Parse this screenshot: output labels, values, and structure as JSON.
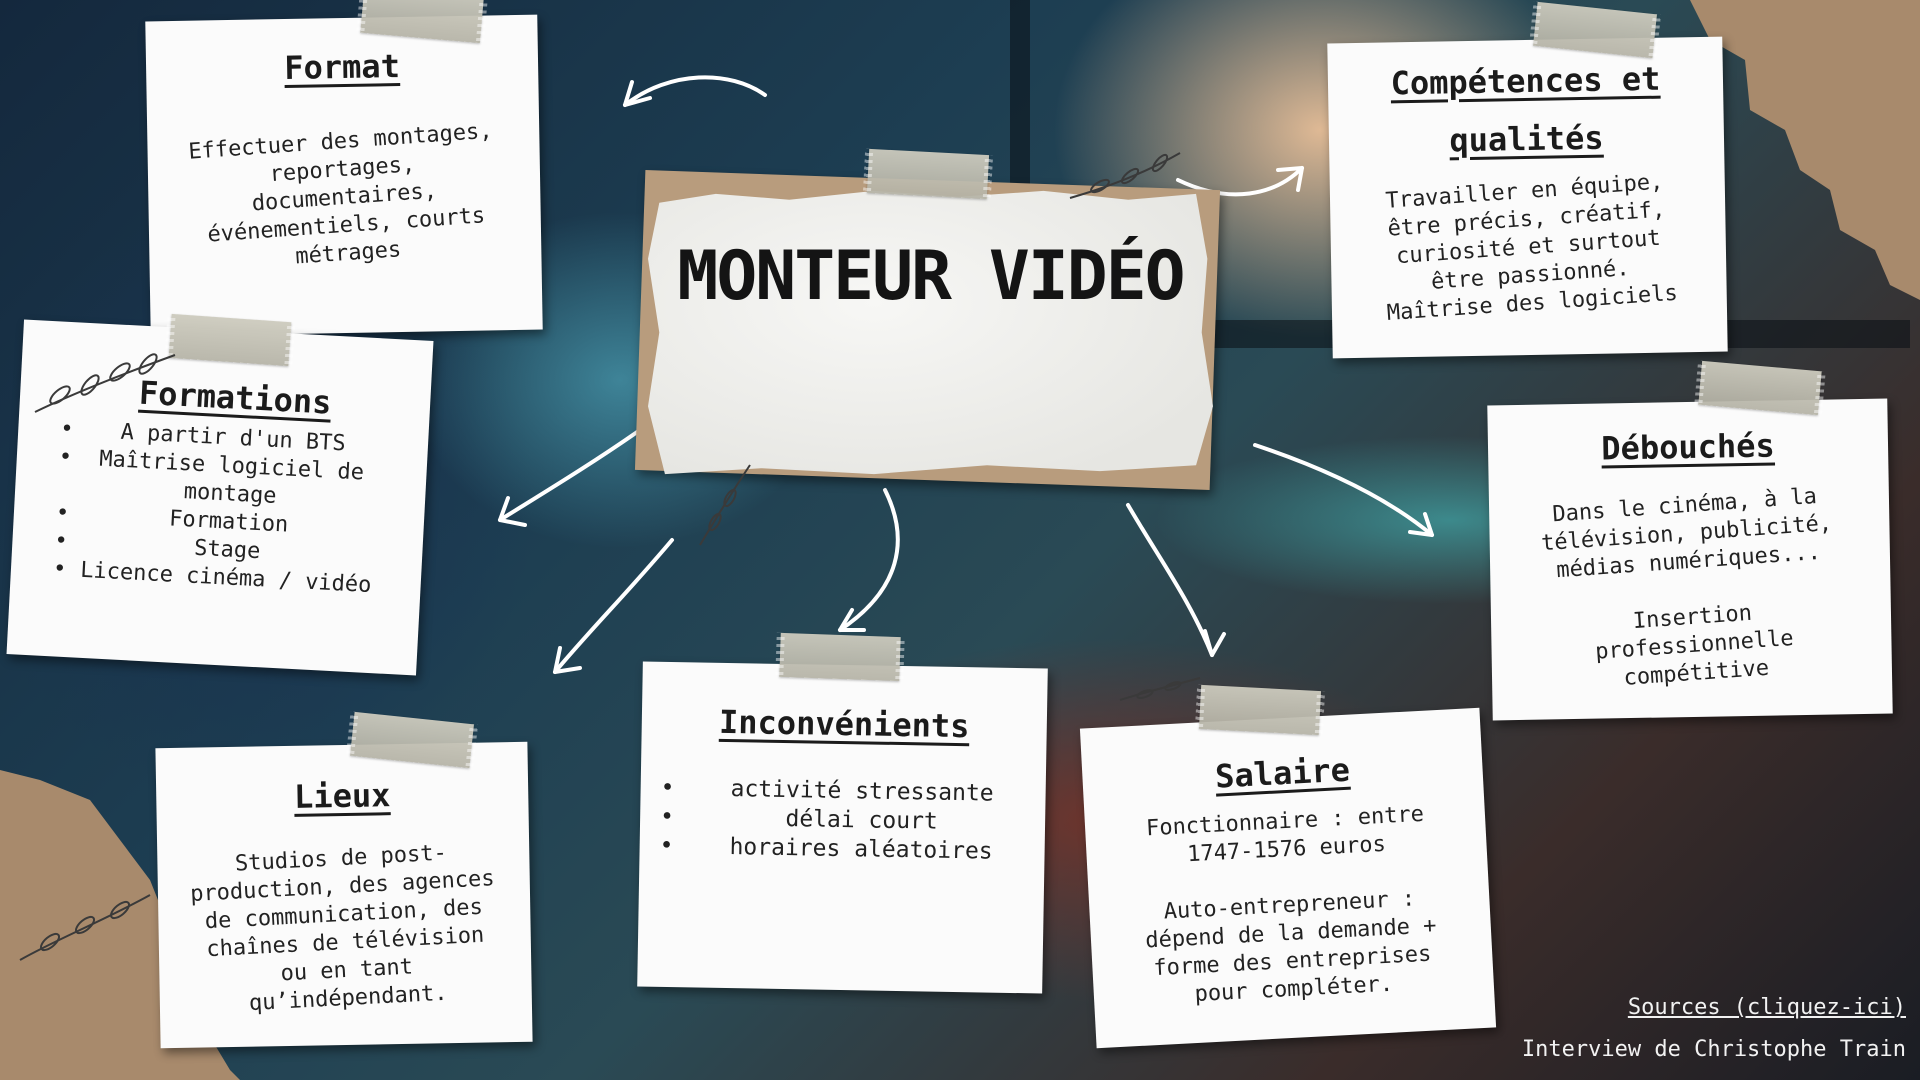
{
  "title": "MONTEUR VIDÉO",
  "cards": {
    "format": {
      "heading": "Format",
      "text": "Effectuer des montages,\nreportages,\ndocumentaires,\névénementiels, courts\nmétrages"
    },
    "competences": {
      "heading": "Compétences et qualités",
      "text": "Travailler en équipe,\nêtre précis, créatif,\ncuriosité et surtout\nêtre passionné.\nMaîtrise des logiciels"
    },
    "formations": {
      "heading": "Formations",
      "items": [
        "A partir d'un BTS",
        "Maîtrise logiciel de montage",
        "Formation",
        "Stage",
        "Licence cinéma / vidéo"
      ]
    },
    "debouches": {
      "heading": "Débouchés",
      "text": "Dans le cinéma, à la\ntélévision, publicité,\nmédias numériques...\n\nInsertion\nprofessionnelle\ncompétitive"
    },
    "lieux": {
      "heading": "Lieux",
      "text": "Studios de post-\nproduction, des agences\nde communication, des\nchaînes de télévision\nou en tant\nqu’indépendant."
    },
    "inconvenients": {
      "heading": "Inconvénients",
      "items": [
        "activité stressante",
        "délai court",
        "horaires aléatoires"
      ]
    },
    "salaire": {
      "heading": "Salaire",
      "text": "Fonctionnaire : entre\n1747-1576 euros\n\nAuto-entrepreneur :\ndépend de la demande +\nforme des entreprises\npour compléter."
    }
  },
  "footer": {
    "sources_link": "Sources (cliquez-ici)",
    "interview": "Interview de Christophe Train"
  },
  "colors": {
    "note_bg": "#fbfbfb",
    "tape": "#c9c7b8",
    "kraft": "#b89c7d",
    "arrow": "#ffffff",
    "text": "#1b1b1b"
  },
  "icons": {
    "bullet": "•",
    "leaf": "leaf-branch-icon",
    "arrow": "curved-arrow-icon"
  }
}
